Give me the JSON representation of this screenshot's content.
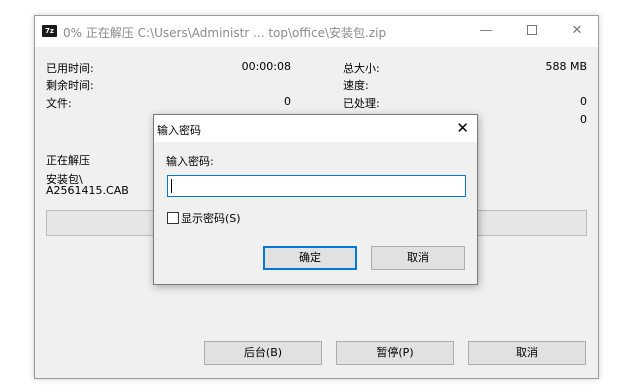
{
  "window": {
    "icon_text": "7z",
    "title": "0% 正在解压 C:\\Users\\Administr ... top\\office\\安装包.zip",
    "minimize_glyph": "—",
    "close_glyph": "✕"
  },
  "stats": {
    "elapsed_label": "已用时间:",
    "elapsed_value": "00:00:08",
    "remaining_label": "剩余时间:",
    "files_label": "文件:",
    "files_value": "0",
    "total_size_label": "总大小:",
    "total_size_value": "588 MB",
    "speed_label": "速度:",
    "processed_label": "已处理:",
    "processed_value": "0",
    "compressed_value": "0"
  },
  "current": {
    "heading": "正在解压",
    "folder": "安装包\\",
    "file": "A2561415.CAB"
  },
  "progress": {
    "percent": 0
  },
  "buttons": {
    "background": "后台(B)",
    "pause": "暂停(P)",
    "cancel": "取消"
  },
  "password_dialog": {
    "title": "输入密码",
    "close_glyph": "✕",
    "prompt": "输入密码:",
    "password_value": "",
    "show_password_label": "显示密码(S)",
    "show_password_checked": false,
    "ok": "确定",
    "cancel": "取消"
  }
}
